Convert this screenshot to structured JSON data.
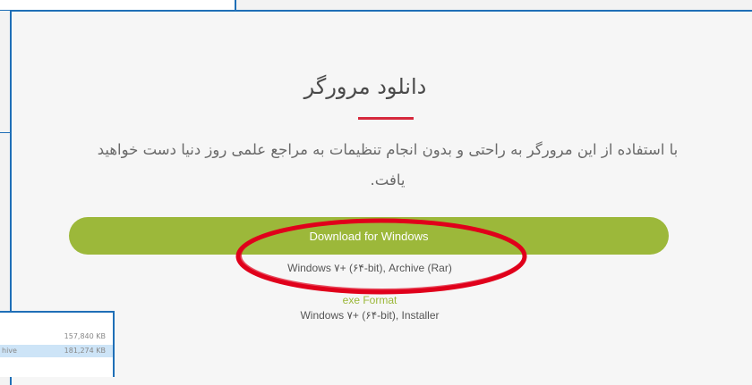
{
  "page": {
    "title": "دانلود مرورگر",
    "description": "با استفاده از این مرورگر به راحتی و بدون انجام تنظیمات به مراجع علمی روز دنیا دست خواهید یافت.",
    "download_button_label": "Download for Windows",
    "archive_info": "Windows ۷+ (۶۴-bit), Archive (Rar)",
    "exe_format_label": "exe Format",
    "installer_info": "Windows ۷+ (۶۴-bit), Installer"
  },
  "file_list": {
    "rows": [
      {
        "type": "",
        "size": "157,840 KB"
      },
      {
        "type": "hive",
        "size": "181,274 KB"
      }
    ]
  },
  "colors": {
    "accent_green": "#9cb83a",
    "underline_red": "#d6283c",
    "highlight_red": "#e0001b",
    "window_border_blue": "#1f6fb7",
    "selected_row": "#cde4f7"
  }
}
